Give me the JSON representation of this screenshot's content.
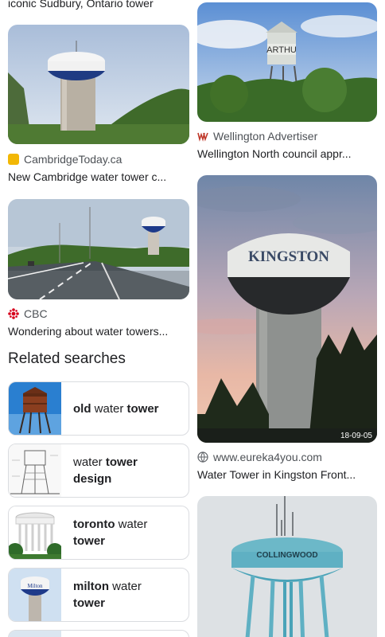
{
  "top_left_caption": "iconic Sudbury, Ontario tower",
  "results": [
    {
      "source": "CambridgeToday.ca",
      "title": "New Cambridge water tower c...",
      "favicon_color": "#f2b705"
    },
    {
      "source": "Wellington Advertiser",
      "title": "Wellington North council appr...",
      "favicon_color": "#c0392b",
      "sign_text": "ARTHU"
    },
    {
      "source": "CBC",
      "title": "Wondering about water towers...",
      "favicon_color": "#d6001c"
    },
    {
      "source": "www.eureka4you.com",
      "title": "Water Tower in Kingston Front...",
      "tower_text": "KINGSTON",
      "date_stamp": "18-09-05"
    },
    {
      "tower_text": "COLLINGWOOD"
    }
  ],
  "related": {
    "heading": "Related searches",
    "items": [
      {
        "parts": [
          {
            "t": "old",
            "b": true
          },
          {
            "t": " water ",
            "b": false
          },
          {
            "t": "tower",
            "b": true
          }
        ]
      },
      {
        "parts": [
          {
            "t": "water ",
            "b": false
          },
          {
            "t": "tower",
            "b": true
          },
          {
            "t": " design",
            "b": true
          }
        ]
      },
      {
        "parts": [
          {
            "t": "toronto",
            "b": true
          },
          {
            "t": " water ",
            "b": false
          },
          {
            "t": "tower",
            "b": true
          }
        ]
      },
      {
        "parts": [
          {
            "t": "milton",
            "b": true
          },
          {
            "t": " water ",
            "b": false
          },
          {
            "t": "tower",
            "b": true
          }
        ],
        "thumb_text": "Milton"
      }
    ]
  }
}
